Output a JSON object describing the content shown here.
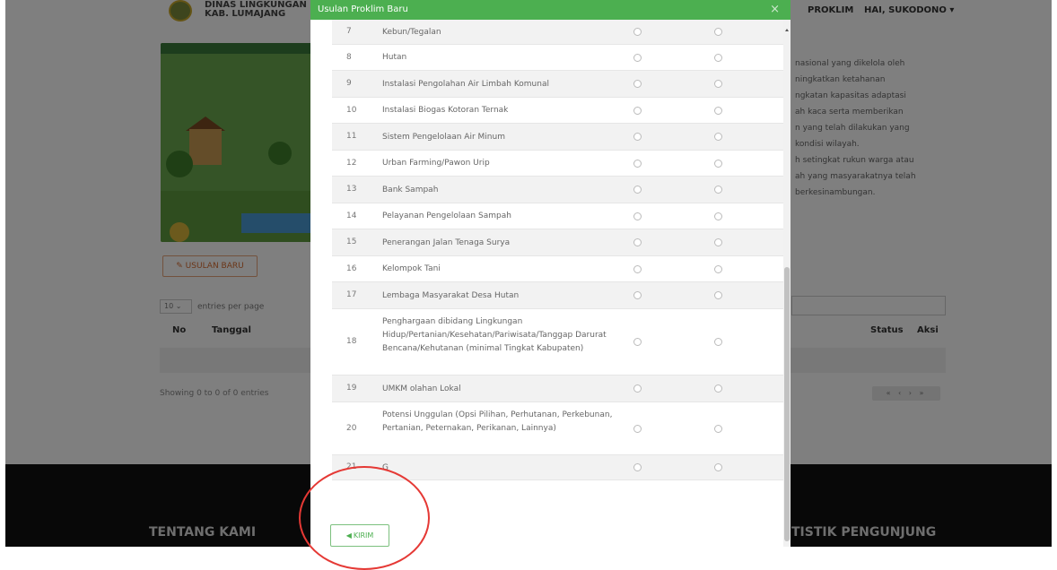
{
  "header": {
    "site_title_line1": "DINAS LINGKUNGAN I",
    "site_title_line2": "KAB. LUMAJANG",
    "nav_proklim": "PROKLIM",
    "nav_user": "HAI, SUKODONO ▾"
  },
  "page": {
    "usulan_baru_button": "✎ USULAN BARU",
    "entries_select": "10 ⌄",
    "entries_label": "entries per page",
    "columns": [
      "No",
      "Tanggal",
      "Status",
      "Aksi"
    ],
    "showing_text": "Showing 0 to 0 of 0 entries",
    "pager": "« ‹ › »",
    "description_lines": [
      "nasional yang dikelola oleh",
      "ningkatkan ketahanan",
      "ngkatan kapasitas adaptasi",
      "ah kaca serta memberikan",
      "n yang telah dilakukan yang",
      "kondisi wilayah.",
      "h setingkat rukun warga atau",
      "ah yang masyarakatnya telah",
      "berkesinambungan."
    ]
  },
  "footer": {
    "tentang_kami": "TENTANG KAMI",
    "statistik": "TISTIK PENGUNJUNG"
  },
  "modal": {
    "title": "Usulan Proklim Baru",
    "close_label": "×",
    "submit_label": "KIRIM",
    "items": [
      {
        "no": "7",
        "name": "Kebun/Tegalan"
      },
      {
        "no": "8",
        "name": "Hutan"
      },
      {
        "no": "9",
        "name": "Instalasi Pengolahan Air Limbah Komunal"
      },
      {
        "no": "10",
        "name": "Instalasi Biogas Kotoran Ternak"
      },
      {
        "no": "11",
        "name": "Sistem Pengelolaan Air Minum"
      },
      {
        "no": "12",
        "name": "Urban Farming/Pawon Urip"
      },
      {
        "no": "13",
        "name": "Bank Sampah"
      },
      {
        "no": "14",
        "name": "Pelayanan Pengelolaan Sampah"
      },
      {
        "no": "15",
        "name": "Penerangan Jalan Tenaga Surya"
      },
      {
        "no": "16",
        "name": "Kelompok Tani"
      },
      {
        "no": "17",
        "name": "Lembaga Masyarakat Desa Hutan"
      },
      {
        "no": "18",
        "name": "Penghargaan dibidang Lingkungan Hidup/Pertanian/Kesehatan/Pariwisata/Tanggap Darurat Bencana/Kehutanan (minimal Tingkat Kabupaten)"
      },
      {
        "no": "19",
        "name": "UMKM olahan Lokal"
      },
      {
        "no": "20",
        "name": "Potensi Unggulan (Opsi Pilihan, Perhutanan, Perkebunan, Pertanian, Peternakan, Perikanan, Lainnya)"
      },
      {
        "no": "21",
        "name": "G"
      }
    ]
  },
  "colors": {
    "modal_header": "#4caf50",
    "annotation": "#e53935",
    "usulan_button": "#d76b2f"
  }
}
